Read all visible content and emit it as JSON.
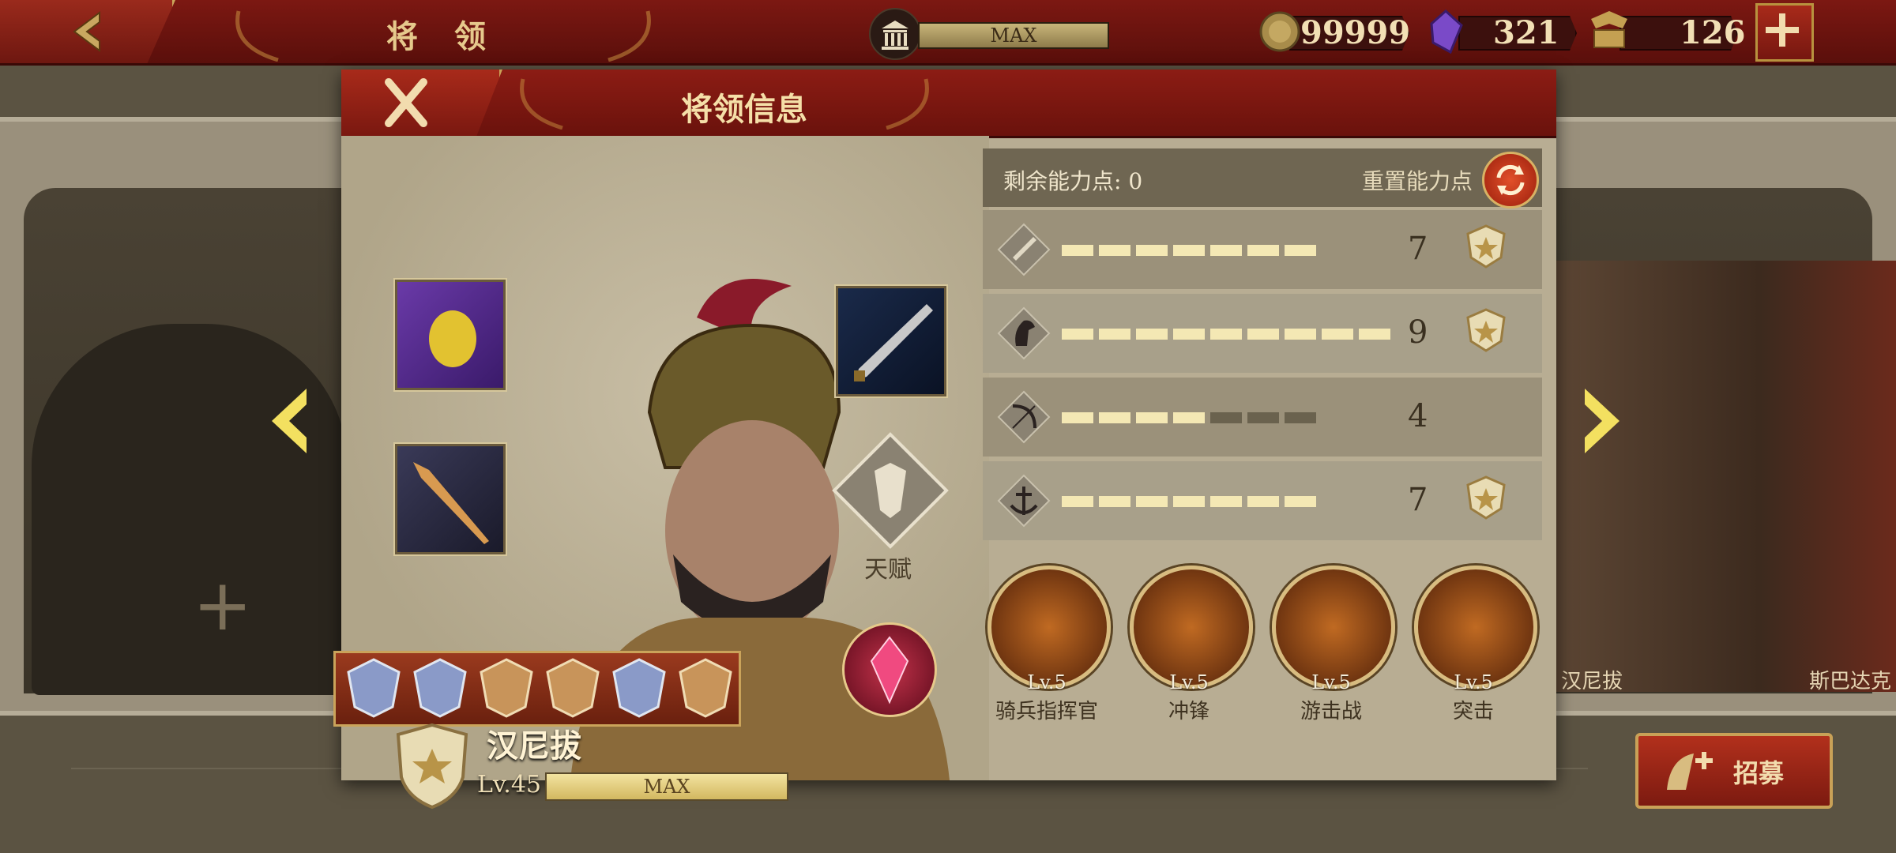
{
  "topbar": {
    "title": "将 领",
    "level_label": "MAX",
    "resources": [
      {
        "icon": "gold-coin-icon",
        "value": "99999"
      },
      {
        "icon": "purple-gem-icon",
        "value": "321"
      },
      {
        "icon": "spqr-eagle-icon",
        "value": "126"
      }
    ]
  },
  "modal": {
    "title": "将领信息",
    "talent_label": "天赋",
    "hero": {
      "name": "汉尼拔",
      "level": "Lv.45",
      "xp_label": "MAX"
    },
    "ability_points_label": "剩余能力点: 0",
    "reset_label": "重置能力点",
    "stats": [
      {
        "icon": "sword-icon",
        "value": "7",
        "filled": 7,
        "max": 7,
        "badge": true
      },
      {
        "icon": "horse-icon",
        "value": "9",
        "filled": 9,
        "max": 9,
        "badge": true
      },
      {
        "icon": "bow-icon",
        "value": "4",
        "filled": 4,
        "max": 7,
        "badge": false
      },
      {
        "icon": "anchor-icon",
        "value": "7",
        "filled": 7,
        "max": 7,
        "badge": true
      }
    ],
    "skills": [
      {
        "level": "Lv.5",
        "name": "骑兵指挥官"
      },
      {
        "level": "Lv.5",
        "name": "冲锋"
      },
      {
        "level": "Lv.5",
        "name": "游击战"
      },
      {
        "level": "Lv.5",
        "name": "突击"
      }
    ]
  },
  "background": {
    "hero_names": [
      "汉尼拔",
      "斯巴达克"
    ],
    "recruit_label": "招募"
  },
  "colors": {
    "header_red": "#7c1812",
    "gold": "#caa55a",
    "panel": "#b8ad93"
  }
}
